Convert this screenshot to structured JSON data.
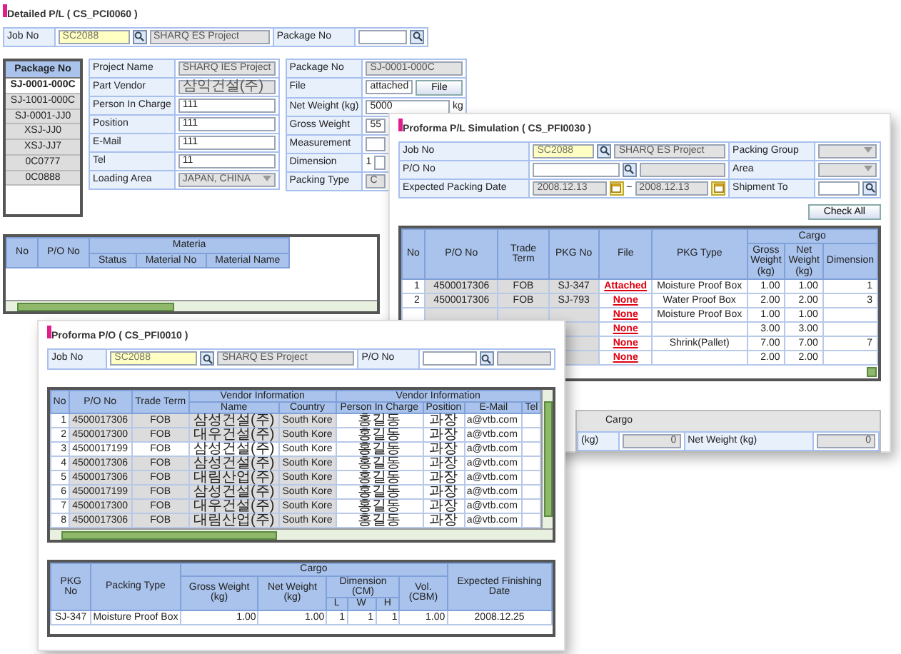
{
  "detailed_pl": {
    "title": "Detailed P/L ( CS_PCI0060 )",
    "header": [
      [
        {
          "label": "Job No",
          "fields": [
            {
              "kind": "input",
              "value": "SC2088",
              "highlighted": true
            },
            {
              "kind": "search"
            },
            {
              "kind": "input",
              "value": "SHARQ ES Project",
              "readonly": true
            }
          ]
        },
        {
          "label": "Package No",
          "fields": [
            {
              "kind": "input"
            },
            {
              "kind": "search"
            }
          ]
        }
      ]
    ],
    "package_list": {
      "header": "Package No",
      "items": [
        {
          "label": "SJ-0001-000C",
          "selected": true
        },
        {
          "label": "SJ-1001-000C",
          "selected": false
        },
        {
          "label": "SJ-0001-JJ0",
          "selected": false
        },
        {
          "label": "XSJ-JJ0",
          "selected": false
        },
        {
          "label": "XSJ-JJ7",
          "selected": false
        },
        {
          "label": "0C0777",
          "selected": false
        },
        {
          "label": "0C0888",
          "selected": false
        }
      ]
    },
    "left_form": [
      [
        {
          "label": "Project Name",
          "fields": [
            {
              "kind": "input",
              "value": "SHARQ IES Project",
              "readonly": true
            }
          ]
        }
      ],
      [
        {
          "label": "Part Vendor",
          "fields": [
            {
              "kind": "input",
              "value": "삼익건설(주)",
              "readonly": true
            }
          ]
        }
      ],
      [
        {
          "label": "Person In Charge",
          "fields": [
            {
              "kind": "input",
              "value": "111"
            }
          ]
        }
      ],
      [
        {
          "label": "Position",
          "fields": [
            {
              "kind": "input",
              "value": "111"
            }
          ]
        }
      ],
      [
        {
          "label": "E-Mail",
          "fields": [
            {
              "kind": "input",
              "value": "111"
            }
          ]
        }
      ],
      [
        {
          "label": "Tel",
          "fields": [
            {
              "kind": "input",
              "value": "11"
            }
          ]
        }
      ],
      [
        {
          "label": "Loading Area",
          "fields": [
            {
              "kind": "select",
              "value": "JAPAN, CHINA"
            }
          ]
        }
      ]
    ],
    "right_form": [
      [
        {
          "label": "Package No",
          "fields": [
            {
              "kind": "input",
              "value": "SJ-0001-000C",
              "readonly": true
            }
          ]
        }
      ],
      [
        {
          "label": "File",
          "fields": [
            {
              "kind": "input",
              "value": "attached"
            },
            {
              "kind": "button",
              "label": "File"
            }
          ]
        }
      ],
      [
        {
          "label": "Net Weight (kg)",
          "fields": [
            {
              "kind": "input",
              "value": "5000"
            },
            {
              "kind": "text",
              "value": "kg"
            }
          ]
        }
      ],
      [
        {
          "label": "Gross Weight",
          "fields": [
            {
              "kind": "input",
              "value": "55"
            }
          ]
        }
      ],
      [
        {
          "label": "Measurement",
          "fields": [
            {
              "kind": "input"
            }
          ]
        }
      ],
      [
        {
          "label": "Dimension",
          "fields": [
            {
              "kind": "text",
              "value": "1"
            },
            {
              "kind": "input"
            }
          ]
        }
      ],
      [
        {
          "label": "Packing Type",
          "fields": [
            {
              "kind": "input",
              "value": "C",
              "readonly": true
            }
          ]
        }
      ]
    ],
    "table": {
      "columns": [
        {
          "label": "No"
        },
        {
          "label": "P/O No"
        },
        {
          "label": "Materia",
          "colspan": 3,
          "columns": [
            {
              "label": "Status"
            },
            {
              "label": "Material No"
            },
            {
              "label": "Material Name"
            }
          ]
        }
      ]
    }
  },
  "simulation": {
    "title": "Proforma P/L Simulation ( CS_PFI0030 )",
    "form": [
      [
        {
          "label": "Job No",
          "fields": [
            {
              "kind": "input",
              "value": "SC2088",
              "highlighted": true
            },
            {
              "kind": "search"
            },
            {
              "kind": "input",
              "value": "SHARQ ES Project",
              "readonly": true
            }
          ]
        },
        {
          "label": "Packing Group",
          "fields": [
            {
              "kind": "select"
            }
          ]
        }
      ],
      [
        {
          "label": "P/O No",
          "fields": [
            {
              "kind": "input"
            },
            {
              "kind": "search"
            },
            {
              "kind": "input",
              "readonly": true
            }
          ]
        },
        {
          "label": "Area",
          "fields": [
            {
              "kind": "select"
            }
          ]
        }
      ],
      [
        {
          "label": "Expected Packing Date",
          "fields": [
            {
              "kind": "input",
              "value": "2008.12.13",
              "readonly": true
            },
            {
              "kind": "calendar"
            },
            {
              "kind": "text",
              "value": "~"
            },
            {
              "kind": "input",
              "value": "2008.12.13",
              "readonly": true
            },
            {
              "kind": "calendar"
            }
          ]
        },
        {
          "label": "Shipment To",
          "fields": [
            {
              "kind": "input"
            },
            {
              "kind": "search"
            }
          ]
        }
      ]
    ],
    "button": "Check All",
    "table": {
      "columns": [
        {
          "label": "No",
          "kind": "number"
        },
        {
          "label": "P/O No",
          "kind": "key"
        },
        {
          "label": "Trade Term",
          "kind": "key"
        },
        {
          "label": "PKG No",
          "kind": "key"
        },
        {
          "label": "File",
          "kind": "center"
        },
        {
          "label": "PKG Type",
          "kind": "center"
        },
        {
          "label": "Cargo",
          "colspan": 3,
          "columns": [
            {
              "label": "Gross Weight (kg)",
              "kind": "number"
            },
            {
              "label": "Net Weight (kg)",
              "kind": "number"
            },
            {
              "label": "Dimension",
              "kind": "number"
            }
          ]
        }
      ],
      "rows": [
        {
          "cells": [
            "1",
            "4500017306",
            "FOB",
            "SJ-347",
            {
              "kind": "link",
              "text": "Attached"
            },
            "Moisture Proof Box",
            "1.00",
            "1.00",
            "1"
          ]
        },
        {
          "cells": [
            "2",
            "4500017306",
            "FOB",
            "SJ-793",
            {
              "kind": "link",
              "text": "None"
            },
            "Water Proof Box",
            "2.00",
            "2.00",
            "3"
          ]
        },
        {
          "cells": [
            null,
            null,
            null,
            null,
            {
              "kind": "link",
              "text": "None"
            },
            "Moisture Proof Box",
            "1.00",
            "1.00",
            null
          ]
        },
        {
          "cells": [
            null,
            null,
            null,
            null,
            {
              "kind": "link",
              "text": "None"
            },
            null,
            "3.00",
            "3.00",
            null
          ]
        },
        {
          "cells": [
            null,
            null,
            null,
            null,
            {
              "kind": "link",
              "text": "None"
            },
            "Shrink(Pallet)",
            "7.00",
            "7.00",
            "7"
          ]
        },
        {
          "cells": [
            null,
            null,
            null,
            null,
            {
              "kind": "link",
              "text": "None"
            },
            null,
            "2.00",
            "2.00",
            null
          ]
        }
      ]
    },
    "cargo": {
      "title": "Cargo",
      "fields": [
        {
          "label": "(kg)",
          "fields": [
            {
              "kind": "input",
              "value": "0",
              "readonly": true
            }
          ]
        },
        {
          "label": "Net Weight (kg)",
          "fields": [
            {
              "kind": "input",
              "value": "0",
              "readonly": true
            }
          ]
        }
      ]
    }
  },
  "proforma_po": {
    "title": "Proforma P/O ( CS_PFI0010 )",
    "form": [
      [
        {
          "label": "Job No",
          "fields": [
            {
              "kind": "input",
              "value": "SC2088",
              "highlighted": true
            },
            {
              "kind": "search"
            },
            {
              "kind": "input",
              "value": "SHARQ ES Project",
              "readonly": true
            }
          ]
        },
        {
          "label": "P/O No",
          "fields": [
            {
              "kind": "input"
            },
            {
              "kind": "search"
            },
            {
              "kind": "input",
              "readonly": true
            }
          ]
        }
      ]
    ],
    "table": {
      "columns": [
        {
          "label": "No",
          "kind": "number"
        },
        {
          "label": "P/O No",
          "kind": "key"
        },
        {
          "label": "Trade Term",
          "kind": "key"
        },
        {
          "label": "Vendor Information",
          "colspan": 2,
          "columns": [
            {
              "label": "Name",
              "kind": "key"
            },
            {
              "label": "Country",
              "kind": "key"
            }
          ]
        },
        {
          "label": "Vendor Information",
          "colspan": 4,
          "columns": [
            {
              "label": "Person In Charge",
              "kind": "center"
            },
            {
              "label": "Position",
              "kind": "center"
            },
            {
              "label": "E-Mail",
              "kind": "text"
            },
            {
              "label": "Tel",
              "kind": "text"
            }
          ]
        }
      ],
      "rows": [
        {
          "selected": false,
          "cells": [
            "1",
            "4500017306",
            "FOB",
            "삼성건설(주)",
            "South Kore",
            "홍길동",
            "과장",
            "a@vtb.com",
            null
          ]
        },
        {
          "selected": false,
          "cells": [
            "2",
            "4500017300",
            "FOB",
            "대우건설(주)",
            "South Kore",
            "홍길동",
            "과장",
            "a@vtb.com",
            null
          ]
        },
        {
          "selected": true,
          "cells": [
            "3",
            "4500017199",
            "FOB",
            "삼성건설(주)",
            "South Kore",
            "홍길동",
            "과장",
            "a@vtb.com",
            null
          ]
        },
        {
          "selected": false,
          "cells": [
            "4",
            "4500017306",
            "FOB",
            "삼성건설(주)",
            "South Kore",
            "홍길동",
            "과장",
            "a@vtb.com",
            null
          ]
        },
        {
          "selected": false,
          "cells": [
            "5",
            "4500017306",
            "FOB",
            "대림산업(주)",
            "South Kore",
            "홍길동",
            "과장",
            "a@vtb.com",
            null
          ]
        },
        {
          "selected": false,
          "cells": [
            "6",
            "4500017199",
            "FOB",
            "삼성건설(주)",
            "South Kore",
            "홍길동",
            "과장",
            "a@vtb.com",
            null
          ]
        },
        {
          "selected": false,
          "cells": [
            "7",
            "4500017300",
            "FOB",
            "대우건설(주)",
            "South Kore",
            "홍길동",
            "과장",
            "a@vtb.com",
            null
          ]
        },
        {
          "selected": false,
          "cells": [
            "8",
            "4500017306",
            "FOB",
            "대림산업(주)",
            "South Kore",
            "홍길동",
            "과장",
            "a@vtb.com",
            null
          ]
        }
      ]
    },
    "detail_table": {
      "columns": [
        {
          "label": "PKG No",
          "kind": "center"
        },
        {
          "label": "Packing Type",
          "kind": "text"
        },
        {
          "label": "Cargo",
          "colspan": 6,
          "columns": [
            {
              "label": "Gross Weight (kg)",
              "kind": "number"
            },
            {
              "label": "Net Weight (kg)",
              "kind": "number"
            },
            {
              "label": "Dimension (CM)",
              "colspan": 3,
              "columns": [
                {
                  "label": "L",
                  "kind": "number"
                },
                {
                  "label": "W",
                  "kind": "number"
                },
                {
                  "label": "H",
                  "kind": "number"
                }
              ]
            },
            {
              "label": "Vol.(CBM)",
              "kind": "number"
            }
          ]
        },
        {
          "label": "Expected Finishing Date",
          "kind": "center"
        }
      ],
      "rows": [
        {
          "cells": [
            "SJ-347",
            "Moisture Proof Box",
            "1.00",
            "1.00",
            "1",
            "1",
            "1",
            "1.00",
            "2008.12.25"
          ]
        }
      ]
    }
  }
}
